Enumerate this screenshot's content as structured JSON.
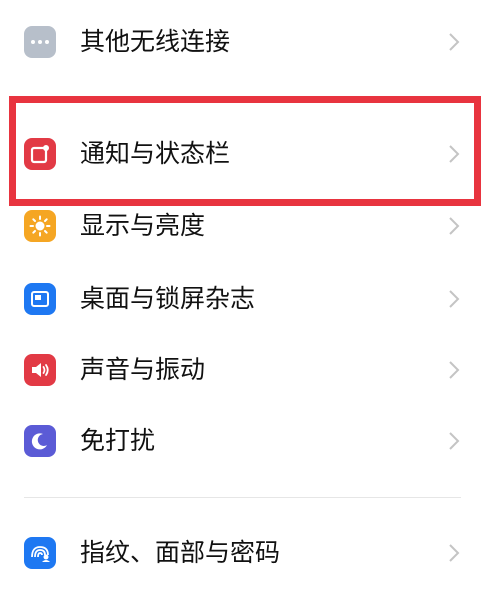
{
  "colors": {
    "highlight": "#e8343f",
    "other_icon_bg": "#b7bfca",
    "notification_icon_bg": "#e23a45",
    "display_icon_bg": "#f5a623",
    "wallpaper_icon_bg": "#1e78f2",
    "sound_icon_bg": "#e23a45",
    "dnd_icon_bg": "#5b5bd6",
    "fingerprint_icon_bg": "#1e78f2",
    "chevron": "#c4c4c4"
  },
  "settings": {
    "items": [
      {
        "label": "其他无线连接",
        "icon": "more-dots-icon"
      },
      {
        "label": "通知与状态栏",
        "icon": "notification-icon"
      },
      {
        "label": "显示与亮度",
        "icon": "sun-icon"
      },
      {
        "label": "桌面与锁屏杂志",
        "icon": "wallpaper-icon"
      },
      {
        "label": "声音与振动",
        "icon": "speaker-icon"
      },
      {
        "label": "免打扰",
        "icon": "moon-icon"
      },
      {
        "label": "指纹、面部与密码",
        "icon": "fingerprint-face-icon"
      }
    ]
  }
}
